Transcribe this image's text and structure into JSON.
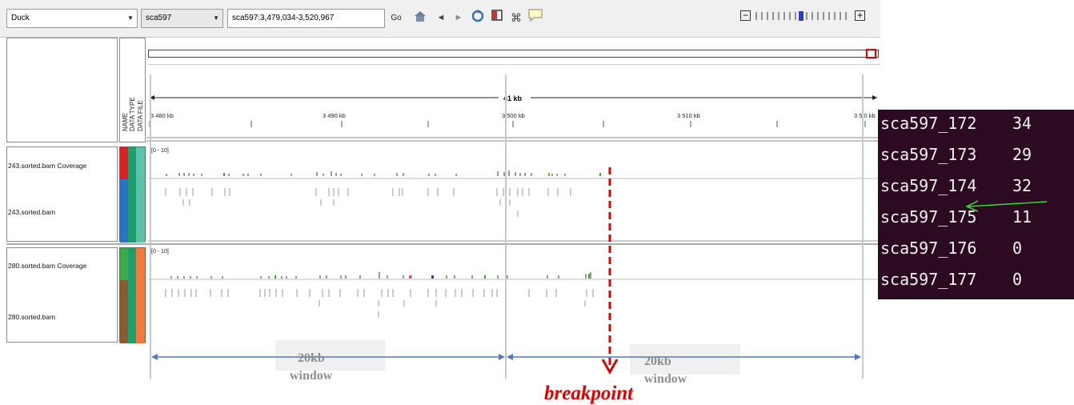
{
  "toolbar": {
    "genome": "Duck",
    "chromosome": "sca597",
    "locus": "sca597:3,479,034-3,520,967",
    "go_label": "Go"
  },
  "ruler": {
    "span_label": "41 kb",
    "ticks": [
      "3 480 kb",
      "3 490 kb",
      "3 500 kb",
      "3 510 kb",
      "3 5 0 kb"
    ]
  },
  "header_columns": [
    "NAME",
    "DATA TYPE",
    "DATA FILE"
  ],
  "tracks": [
    {
      "coverage_name": "243.sorted.bam Coverage",
      "range": "[0 - 10]",
      "alignment_name": "243.sorted.bam"
    },
    {
      "coverage_name": "280.sorted.bam Coverage",
      "range": "[0 - 10]",
      "alignment_name": "280.sorted.bam"
    }
  ],
  "annotations": {
    "window_label_1": "20kb",
    "window_label_2": "window",
    "window2_label_1": "20kb",
    "window2_label_2": "window",
    "breakpoint": "breakpoint"
  },
  "terminal": {
    "rows": [
      {
        "name": "sca597_172",
        "value": "34"
      },
      {
        "name": "sca597_173",
        "value": "29"
      },
      {
        "name": "sca597_174",
        "value": "32"
      },
      {
        "name": "sca597_175",
        "value": "11"
      },
      {
        "name": "sca597_176",
        "value": "0"
      },
      {
        "name": "sca597_177",
        "value": "0"
      }
    ]
  },
  "colors": {
    "breakpoint": "#e00000",
    "window_arrow": "#4a7bbf",
    "terminal_bg": "#2b0a22",
    "pointer_arrow": "#33dd33"
  }
}
